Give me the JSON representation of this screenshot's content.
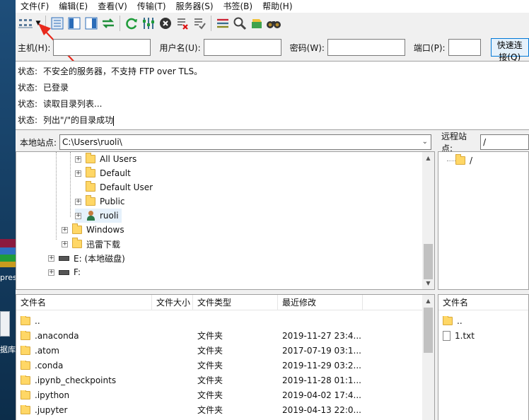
{
  "desktop": {
    "text_pres": "pres",
    "text_ku": "据库"
  },
  "menu": [
    "文件(F)",
    "编辑(E)",
    "查看(V)",
    "传输(T)",
    "服务器(S)",
    "书签(B)",
    "帮助(H)"
  ],
  "quickconnect": {
    "host_label": "主机(H):",
    "user_label": "用户名(U):",
    "pass_label": "密码(W):",
    "port_label": "端口(P):",
    "host_value": "",
    "user_value": "",
    "pass_value": "",
    "port_value": "",
    "connect_button": "快速连接(Q)"
  },
  "log": [
    {
      "label": "状态:",
      "text": "不安全的服务器，不支持 FTP over TLS。"
    },
    {
      "label": "状态:",
      "text": "已登录"
    },
    {
      "label": "状态:",
      "text": "读取目录列表..."
    },
    {
      "label": "状态:",
      "text": "列出\"/\"的目录成功"
    }
  ],
  "local": {
    "site_label": "本地站点:",
    "site_path": "C:\\Users\\ruoli\\",
    "tree": [
      {
        "name": "All Users",
        "icon": "folder-icon",
        "expander": true
      },
      {
        "name": "Default",
        "icon": "folder-icon",
        "expander": true
      },
      {
        "name": "Default User",
        "icon": "folder-icon",
        "expander": false
      },
      {
        "name": "Public",
        "icon": "folder-icon",
        "expander": true
      },
      {
        "name": "ruoli",
        "icon": "user-icon",
        "expander": true
      },
      {
        "name": "Windows",
        "icon": "folder-icon",
        "expander": true
      },
      {
        "name": "迅雷下载",
        "icon": "folder-icon",
        "expander": true
      },
      {
        "name": "E: (本地磁盘)",
        "icon": "drive-icon",
        "expander": true
      },
      {
        "name": "F:",
        "icon": "drive-icon",
        "expander": true
      }
    ],
    "columns": [
      "文件名",
      "文件大小",
      "文件类型",
      "最近修改"
    ],
    "files": [
      {
        "name": "..",
        "size": "",
        "type": "",
        "modified": ""
      },
      {
        "name": ".anaconda",
        "size": "",
        "type": "文件夹",
        "modified": "2019-11-27 23:4..."
      },
      {
        "name": ".atom",
        "size": "",
        "type": "文件夹",
        "modified": "2017-07-19 03:1..."
      },
      {
        "name": ".conda",
        "size": "",
        "type": "文件夹",
        "modified": "2019-11-29 03:2..."
      },
      {
        "name": ".ipynb_checkpoints",
        "size": "",
        "type": "文件夹",
        "modified": "2019-11-28 01:1..."
      },
      {
        "name": ".ipython",
        "size": "",
        "type": "文件夹",
        "modified": "2019-04-02 17:4..."
      },
      {
        "name": ".jupyter",
        "size": "",
        "type": "文件夹",
        "modified": "2019-04-13 22:0..."
      }
    ]
  },
  "remote": {
    "site_label": "远程站点:",
    "site_path": "/",
    "tree": [
      {
        "name": "/"
      }
    ],
    "columns": [
      "文件名"
    ],
    "files": [
      {
        "name": "..",
        "icon": "folder-icon"
      },
      {
        "name": "1.txt",
        "icon": "text-file-icon"
      }
    ]
  }
}
